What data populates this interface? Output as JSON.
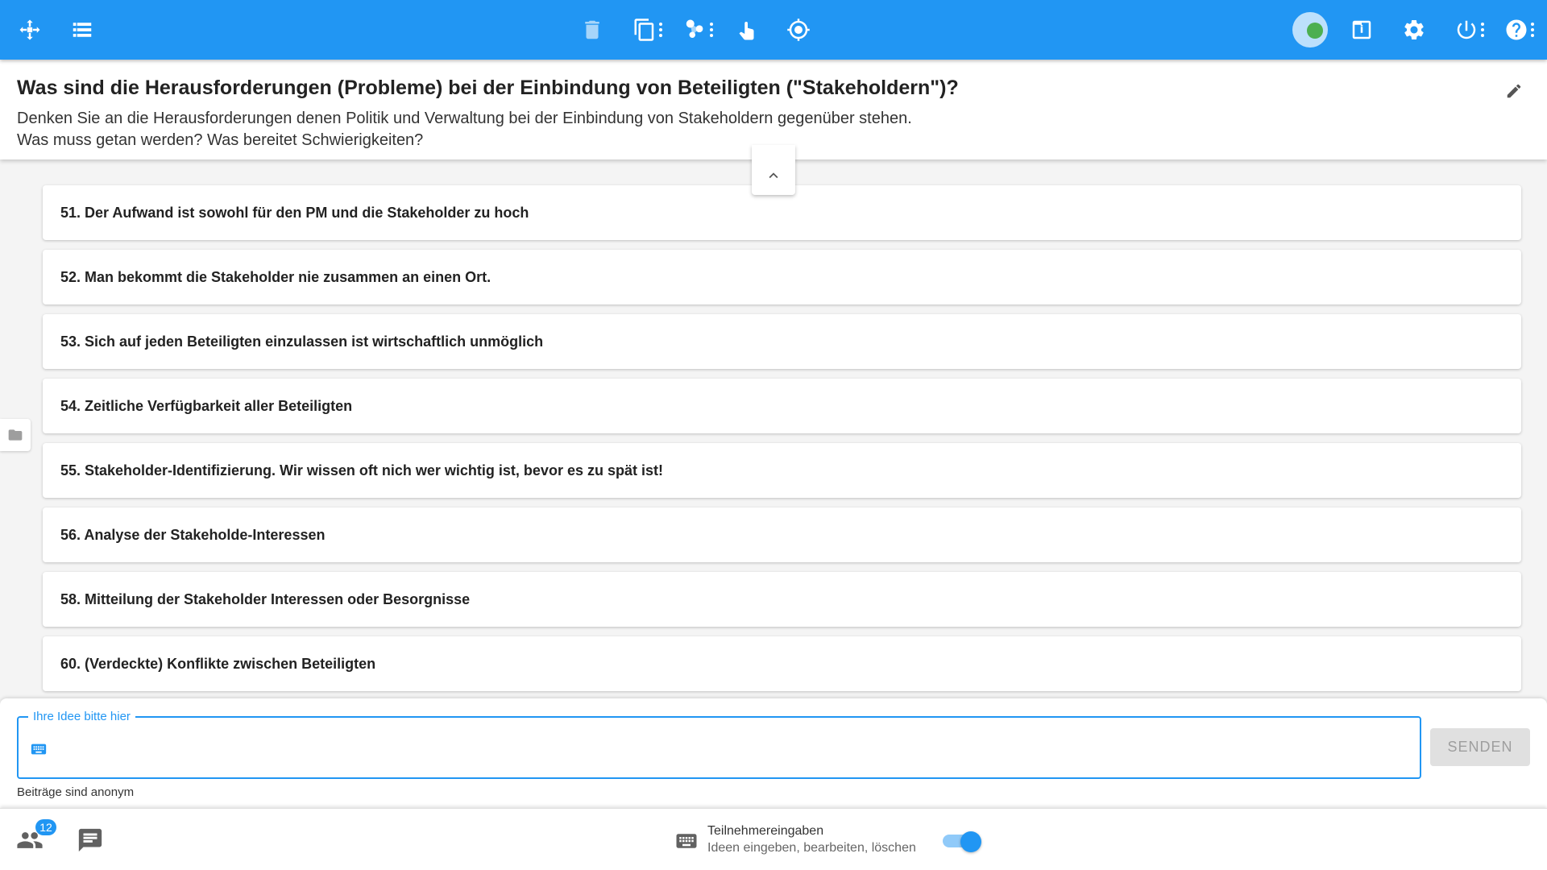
{
  "question": {
    "title": "Was sind die Herausforderungen (Probleme) bei der Einbindung von Beteiligten (\"Stakeholdern\")?",
    "description_line1": "Denken Sie an die Herausforderungen denen Politik und Verwaltung bei der Einbindung von Stakeholdern gegenüber stehen.",
    "description_line2": "Was muss getan werden? Was bereitet Schwierigkeiten?"
  },
  "ideas": [
    "51. Der Aufwand ist sowohl für den PM und die Stakeholder zu hoch",
    "52. Man bekommt die Stakeholder nie zusammen an einen Ort.",
    "53. Sich auf jeden Beteiligten einzulassen ist wirtschaftlich unmöglich",
    "54. Zeitliche Verfügbarkeit aller Beteiligten",
    "55. Stakeholder-Identifizierung. Wir wissen oft nich wer wichtig ist, bevor es zu spät ist!",
    "56. Analyse der Stakeholde-Interessen",
    "58. Mitteilung der Stakeholder Interessen oder Besorgnisse",
    "60. (Verdeckte) Konflikte zwischen Beteiligten"
  ],
  "input": {
    "label": "Ihre Idee bitte hier",
    "value": "",
    "send_label": "SENDEN",
    "hint": "Beiträge sind anonym"
  },
  "bottom": {
    "participants_count": "12",
    "mode_title": "Teilnehmereingaben",
    "mode_subtitle": "Ideen eingeben, bearbeiten, löschen",
    "mode_enabled": true
  },
  "colors": {
    "primary": "#2196f3",
    "status_online": "#4caf50"
  }
}
